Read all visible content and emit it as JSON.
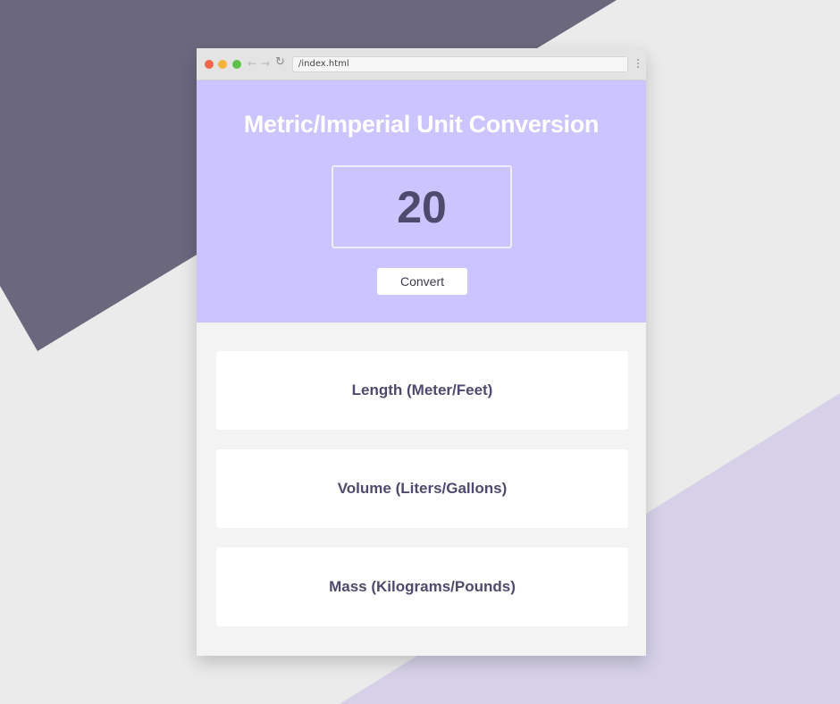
{
  "colors": {
    "background": "#ebebeb",
    "shape_dark": "#6b687e",
    "shape_light": "#d6d1e8",
    "hero_bg": "#cbc4fe",
    "text_dark": "#4e4a6d",
    "window_red": "#f0644a",
    "window_yellow": "#f5b33a",
    "window_green": "#5bc249"
  },
  "browser": {
    "url": "/index.html",
    "back_icon": "arrow-left-icon",
    "forward_icon": "arrow-right-icon",
    "reload_icon": "reload-icon",
    "menu_icon": "vertical-dots-icon",
    "back_glyph": "←",
    "forward_glyph": "→",
    "reload_glyph": "↻"
  },
  "hero": {
    "title": "Metric/Imperial Unit Conversion",
    "input_value": "20",
    "convert_label": "Convert"
  },
  "conversions": [
    {
      "label": "Length (Meter/Feet)"
    },
    {
      "label": "Volume (Liters/Gallons)"
    },
    {
      "label": "Mass (Kilograms/Pounds)"
    }
  ]
}
